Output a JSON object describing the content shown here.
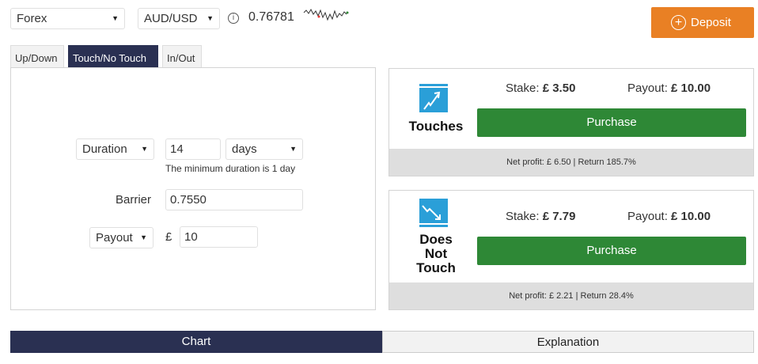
{
  "header": {
    "market": "Forex",
    "symbol": "AUD/USD",
    "price": "0.76781",
    "deposit_label": "Deposit"
  },
  "tabs": [
    {
      "label": "Up/Down",
      "active": false
    },
    {
      "label": "Touch/No Touch",
      "active": true
    },
    {
      "label": "In/Out",
      "active": false
    }
  ],
  "form": {
    "duration_type": "Duration",
    "duration_value": "14",
    "duration_unit": "days",
    "duration_hint": "The minimum duration is 1 day",
    "barrier_label": "Barrier",
    "barrier_value": "0.7550",
    "amount_type": "Payout",
    "currency_symbol": "£",
    "amount_value": "10"
  },
  "contracts": [
    {
      "name": "Touches",
      "stake_label": "Stake:",
      "stake": "£ 3.50",
      "payout_label": "Payout:",
      "payout": "£ 10.00",
      "purchase_label": "Purchase",
      "net_profit": "Net profit: £ 6.50 | Return 185.7%"
    },
    {
      "name_lines": [
        "Does",
        "Not",
        "Touch"
      ],
      "stake_label": "Stake:",
      "stake": "£ 7.79",
      "payout_label": "Payout:",
      "payout": "£ 10.00",
      "purchase_label": "Purchase",
      "net_profit": "Net profit: £ 2.21 | Return 28.4%"
    }
  ],
  "bottom_tabs": [
    {
      "label": "Chart",
      "active": true
    },
    {
      "label": "Explanation",
      "active": false
    }
  ],
  "colors": {
    "accent_orange": "#e98024",
    "navy": "#2a3052",
    "purchase_green": "#2e8836",
    "icon_blue": "#2a9fd8"
  }
}
